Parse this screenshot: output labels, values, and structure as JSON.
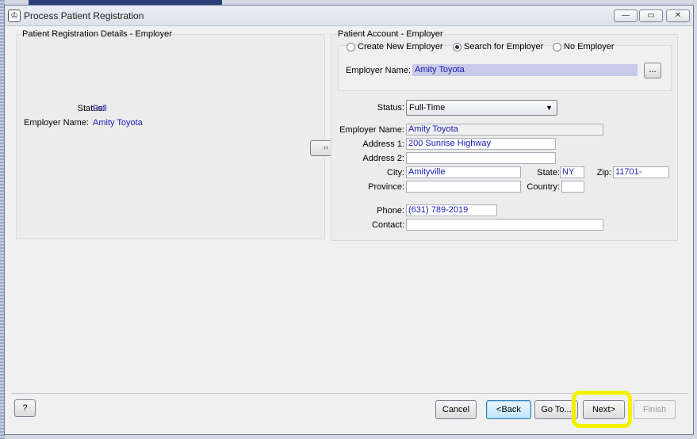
{
  "window": {
    "title": "Process Patient Registration",
    "minimize": "—",
    "restore": "▭",
    "close": "✕"
  },
  "left_panel": {
    "title": "Patient Registration Details - Employer",
    "status_label": "Status:",
    "status_value": "Full",
    "employer_label": "Employer Name:",
    "employer_value": "Amity Toyota"
  },
  "transfer_button": "›› ",
  "right_panel": {
    "title": "Patient Account - Employer",
    "radio_options": [
      {
        "label": "Create New Employer",
        "selected": false
      },
      {
        "label": "Search for Employer",
        "selected": true
      },
      {
        "label": "No Employer",
        "selected": false
      }
    ],
    "search_employer_label": "Employer Name:",
    "search_employer_value": "Amity Toyota",
    "browse_button": "...",
    "status_label": "Status:",
    "status_value": "Full-Time",
    "employer_name_label": "Employer Name:",
    "employer_name_value": "Amity Toyota",
    "address1_label": "Address 1:",
    "address1_value": "200 Sunrise  Highway",
    "address2_label": "Address 2:",
    "address2_value": "",
    "city_label": "City:",
    "city_value": "Amityville",
    "state_label": "State:",
    "state_value": "NY",
    "zip_label": "Zip:",
    "zip_value": "11701-",
    "province_label": "Province:",
    "province_value": "",
    "country_label": "Country:",
    "country_value": "",
    "phone_label": "Phone:",
    "phone_value": "(631) 789-2019",
    "contact_label": "Contact:",
    "contact_value": ""
  },
  "footer": {
    "help": "?",
    "cancel": "Cancel",
    "back": "<Back",
    "goto": "Go To...",
    "next": "Next>",
    "finish": "Finish"
  },
  "colors": {
    "highlight": "#f5f000",
    "value_text": "#1a1ab4"
  }
}
